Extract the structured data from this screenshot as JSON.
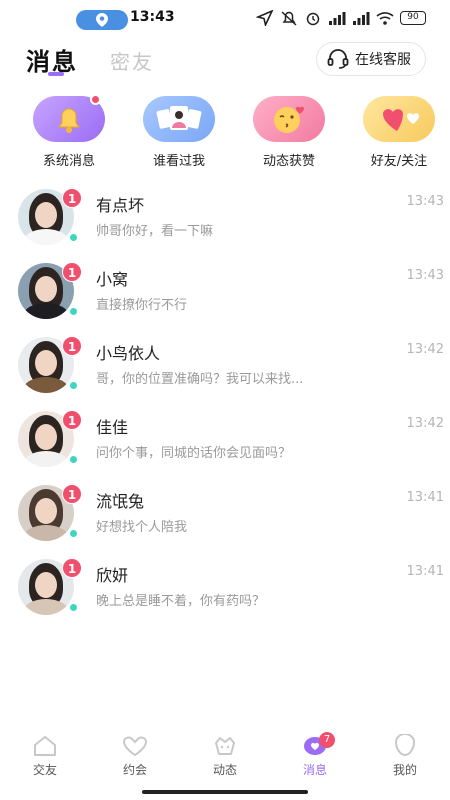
{
  "status_bar": {
    "time": "13:43",
    "battery": "90"
  },
  "header": {
    "tab_active": "消息",
    "tab_inactive": "密友",
    "service_label": "在线客服"
  },
  "shortcuts": [
    {
      "label": "系统消息",
      "icon": "bell-icon",
      "has_dot": true
    },
    {
      "label": "谁看过我",
      "icon": "photo-cards-icon",
      "has_dot": false
    },
    {
      "label": "动态获赞",
      "icon": "kiss-emoji-icon",
      "has_dot": false
    },
    {
      "label": "好友/关注",
      "icon": "heart-icon",
      "has_dot": false
    }
  ],
  "chats": [
    {
      "name": "有点坏",
      "message": "帅哥你好，看一下嘛",
      "time": "13:43",
      "unread": "1"
    },
    {
      "name": "小窝",
      "message": "直接撩你行不行",
      "time": "13:43",
      "unread": "1"
    },
    {
      "name": "小鸟依人",
      "message": "哥，你的位置准确吗？我可以来找...",
      "time": "13:42",
      "unread": "1"
    },
    {
      "name": "佳佳",
      "message": "问你个事，同城的话你会见面吗？",
      "time": "13:42",
      "unread": "1"
    },
    {
      "name": "流氓兔",
      "message": "好想找个人陪我",
      "time": "13:41",
      "unread": "1"
    },
    {
      "name": "欣妍",
      "message": "晚上总是睡不着，你有药吗？",
      "time": "13:41",
      "unread": "1"
    }
  ],
  "bottom_nav": [
    {
      "label": "交友",
      "icon": "home-icon",
      "active": false
    },
    {
      "label": "约会",
      "icon": "heart-outline-icon",
      "active": false
    },
    {
      "label": "动态",
      "icon": "flower-icon",
      "active": false
    },
    {
      "label": "消息",
      "icon": "chat-heart-icon",
      "active": true,
      "badge": "7"
    },
    {
      "label": "我的",
      "icon": "profile-icon",
      "active": false
    }
  ],
  "colors": {
    "accent": "#9b6cf4",
    "badge": "#f0506e",
    "online": "#3fd6c0"
  }
}
